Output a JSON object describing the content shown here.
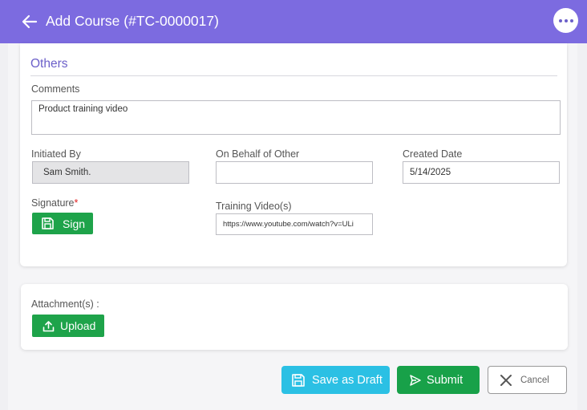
{
  "header": {
    "title": "Add Course (#TC-0000017)",
    "back_icon": "arrow-left-icon",
    "menu_icon": "more-horizontal-icon"
  },
  "others": {
    "title": "Others",
    "comments_label": "Comments",
    "comments_value": "Product training video",
    "initiated_by_label": "Initiated By",
    "initiated_by_value": "Sam Smith.",
    "on_behalf_label": "On Behalf of Other",
    "on_behalf_value": "",
    "created_date_label": "Created Date",
    "created_date_value": "5/14/2025",
    "signature_label": "Signature",
    "signature_required": "*",
    "sign_button": "Sign",
    "training_video_label": "Training Video(s)",
    "training_video_value": "https://www.youtube.com/watch?v=ULi"
  },
  "attachments": {
    "label": "Attachment(s) :",
    "upload_button": "Upload"
  },
  "actions": {
    "save_draft": "Save as Draft",
    "submit": "Submit",
    "cancel": "Cancel"
  },
  "colors": {
    "header": "#7c6be0",
    "section_title": "#6b5fc9",
    "green": "#1ea34a",
    "draft": "#2bc0e4"
  }
}
